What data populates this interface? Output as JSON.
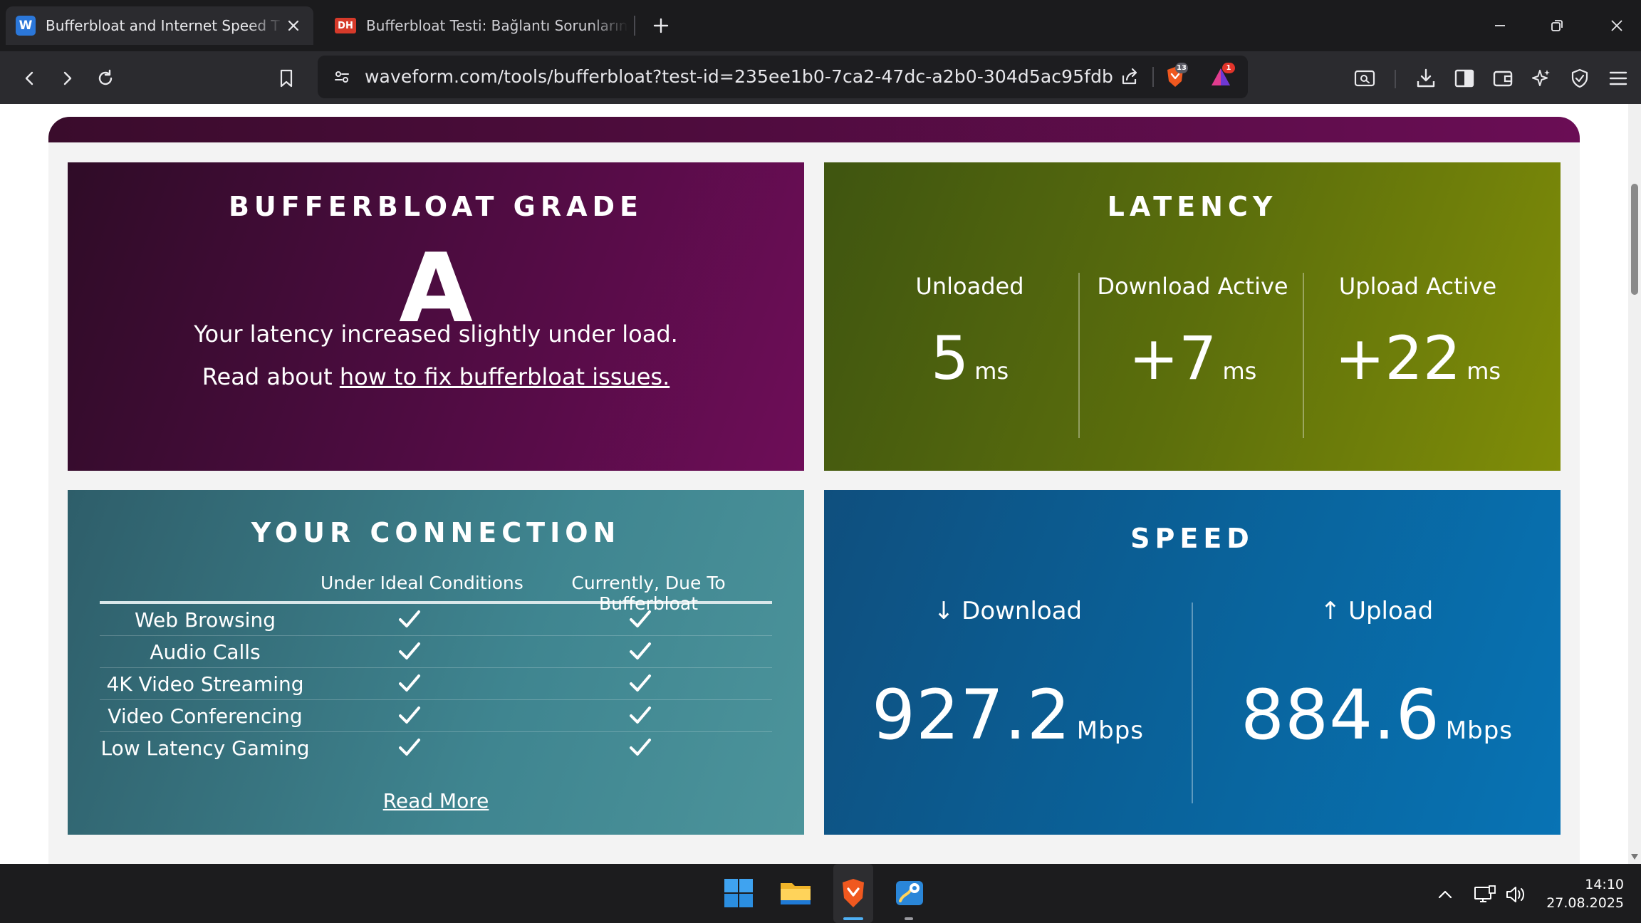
{
  "browser": {
    "tabs": [
      {
        "title": "Bufferbloat and Internet Speed T",
        "favicon": "W",
        "active": true
      },
      {
        "title": "Bufferbloat Testi: Bağlantı Sorunların",
        "favicon": "DH",
        "active": false
      }
    ],
    "url": "waveform.com/tools/bufferbloat?test-id=235ee1b0-7ca2-47dc-a2b0-304d5ac95fdb",
    "shields_count": "13",
    "rewards_count": "1"
  },
  "grade": {
    "heading": "BUFFERBLOAT GRADE",
    "letter": "A",
    "message": "Your latency increased slightly under load.",
    "read_prefix": "Read about ",
    "read_link": "how to fix bufferbloat issues."
  },
  "latency": {
    "heading": "LATENCY",
    "columns": [
      {
        "label": "Unloaded",
        "value": "5",
        "unit": "ms"
      },
      {
        "label": "Download Active",
        "value": "+7",
        "unit": "ms"
      },
      {
        "label": "Upload Active",
        "value": "+22",
        "unit": "ms"
      }
    ]
  },
  "connection": {
    "heading": "YOUR CONNECTION",
    "col_ideal": "Under Ideal Conditions",
    "col_current": "Currently, Due To Bufferbloat",
    "rows": [
      {
        "name": "Web Browsing",
        "ideal": true,
        "current": true
      },
      {
        "name": "Audio Calls",
        "ideal": true,
        "current": true
      },
      {
        "name": "4K Video Streaming",
        "ideal": true,
        "current": true
      },
      {
        "name": "Video Conferencing",
        "ideal": true,
        "current": true
      },
      {
        "name": "Low Latency Gaming",
        "ideal": true,
        "current": true
      }
    ],
    "read_more": "Read More"
  },
  "speed": {
    "heading": "SPEED",
    "download_label": "↓ Download",
    "download_value": "927.2",
    "upload_label": "↑ Upload",
    "upload_value": "884.6",
    "unit": "Mbps"
  },
  "taskbar": {
    "time": "14:10",
    "date": "27.08.2025"
  },
  "colors": {
    "grade_panel": "#5a0c48",
    "latency_panel": "#5b6e0c",
    "connection_panel": "#3f8590",
    "speed_panel": "#09649d"
  }
}
